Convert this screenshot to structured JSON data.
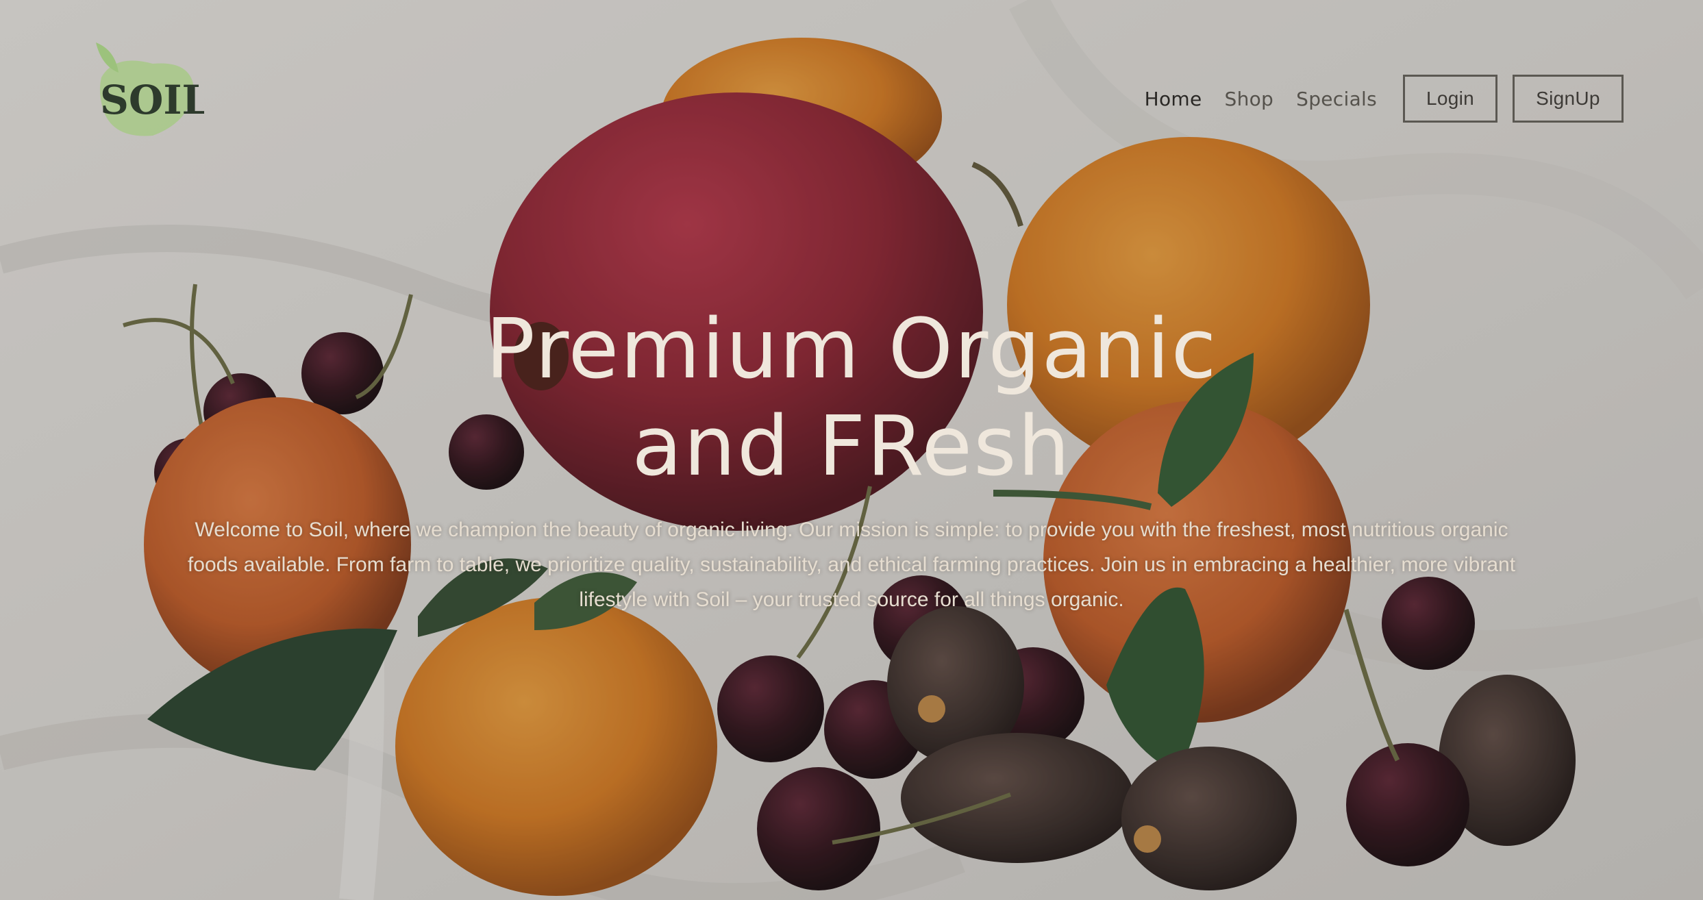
{
  "brand": {
    "logo_text": "SOIL",
    "logo_color": "#a9c98a",
    "logo_text_color": "#2d3a2c"
  },
  "nav": {
    "links": [
      {
        "label": "Home",
        "active": true
      },
      {
        "label": "Shop",
        "active": false
      },
      {
        "label": "Specials",
        "active": false
      }
    ],
    "login_label": "Login",
    "signup_label": "SignUp"
  },
  "hero": {
    "title_line1": "Premium Organic",
    "title_line2": "and FResh",
    "description": "Welcome to Soil, where we champion the beauty of organic living. Our mission is simple: to provide you with the freshest, most nutritious organic foods available. From farm to table, we prioritize quality, sustainability, and ethical farming practices. Join us in embracing a healthier, more vibrant lifestyle with Soil – your trusted source for all things organic.",
    "background_image": "fruit-still-life-photo"
  },
  "colors": {
    "title_text": "#efe7dc",
    "body_text": "#e6ddd0",
    "nav_text": "#55524c",
    "button_border": "#5b5852"
  }
}
